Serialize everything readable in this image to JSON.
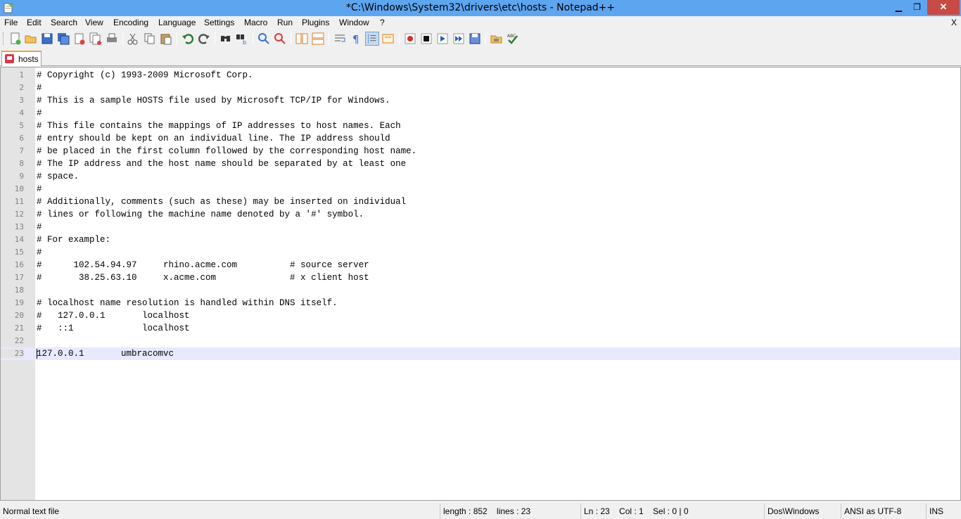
{
  "window": {
    "title": "*C:\\Windows\\System32\\drivers\\etc\\hosts - Notepad++",
    "minimize": "▁",
    "maximize": "❐",
    "close": "✕"
  },
  "menu": {
    "items": [
      "File",
      "Edit",
      "Search",
      "View",
      "Encoding",
      "Language",
      "Settings",
      "Macro",
      "Run",
      "Plugins",
      "Window",
      "?"
    ],
    "close_doc": "X"
  },
  "toolbar": {
    "icons": [
      "new-file-icon",
      "open-file-icon",
      "save-icon",
      "save-all-icon",
      "close-icon",
      "close-all-icon",
      "print-icon",
      "cut-icon",
      "copy-icon",
      "paste-icon",
      "undo-icon",
      "redo-icon",
      "find-icon",
      "replace-icon",
      "zoom-in-icon",
      "zoom-out-icon",
      "sync-vertical-icon",
      "sync-horizontal-icon",
      "word-wrap-icon",
      "show-all-chars-icon",
      "indent-guide-icon",
      "user-lang-icon",
      "record-macro-icon",
      "stop-macro-icon",
      "play-macro-icon",
      "run-macro-multiple-icon",
      "save-macro-icon",
      "folder-launch-icon",
      "spellcheck-icon"
    ]
  },
  "tabs": [
    {
      "label": "hosts",
      "icon": "unsaved-file-icon"
    }
  ],
  "editor": {
    "lines": [
      {
        "num": "1",
        "text": "# Copyright (c) 1993-2009 Microsoft Corp."
      },
      {
        "num": "2",
        "text": "#"
      },
      {
        "num": "3",
        "text": "# This is a sample HOSTS file used by Microsoft TCP/IP for Windows."
      },
      {
        "num": "4",
        "text": "#"
      },
      {
        "num": "5",
        "text": "# This file contains the mappings of IP addresses to host names. Each"
      },
      {
        "num": "6",
        "text": "# entry should be kept on an individual line. The IP address should"
      },
      {
        "num": "7",
        "text": "# be placed in the first column followed by the corresponding host name."
      },
      {
        "num": "8",
        "text": "# The IP address and the host name should be separated by at least one"
      },
      {
        "num": "9",
        "text": "# space."
      },
      {
        "num": "10",
        "text": "#"
      },
      {
        "num": "11",
        "text": "# Additionally, comments (such as these) may be inserted on individual"
      },
      {
        "num": "12",
        "text": "# lines or following the machine name denoted by a '#' symbol."
      },
      {
        "num": "13",
        "text": "#"
      },
      {
        "num": "14",
        "text": "# For example:"
      },
      {
        "num": "15",
        "text": "#"
      },
      {
        "num": "16",
        "text": "#      102.54.94.97     rhino.acme.com          # source server"
      },
      {
        "num": "17",
        "text": "#       38.25.63.10     x.acme.com              # x client host"
      },
      {
        "num": "18",
        "text": ""
      },
      {
        "num": "19",
        "text": "# localhost name resolution is handled within DNS itself."
      },
      {
        "num": "20",
        "text": "#   127.0.0.1       localhost"
      },
      {
        "num": "21",
        "text": "#   ::1             localhost"
      },
      {
        "num": "22",
        "text": ""
      },
      {
        "num": "23",
        "text": "127.0.0.1       umbracomvc"
      }
    ],
    "current_line": "23"
  },
  "status": {
    "file_type": "Normal text file",
    "length": "length : 852    lines : 23",
    "position": "Ln : 23    Col : 1    Sel : 0 | 0",
    "eol": "Dos\\Windows",
    "encoding": "ANSI as UTF-8",
    "mode": "INS"
  }
}
